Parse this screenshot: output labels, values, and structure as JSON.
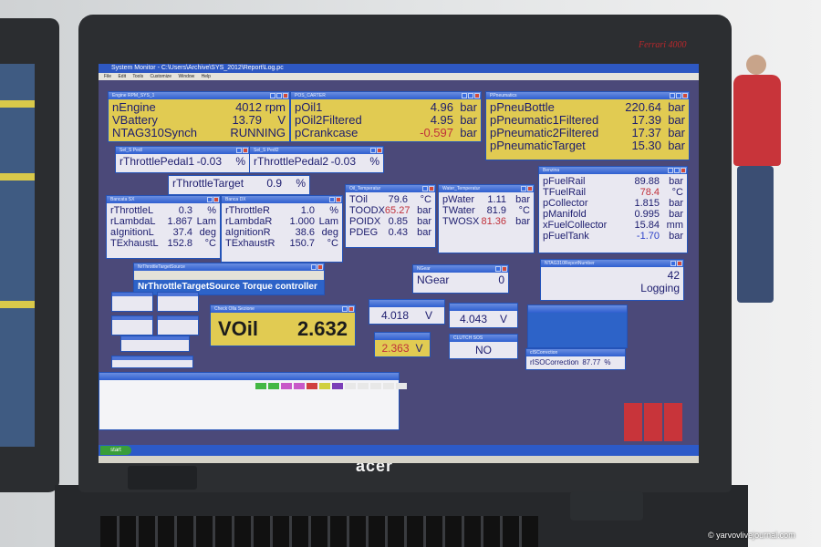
{
  "brand": {
    "lid_badge": "Ferrari 4000",
    "logo": "acer"
  },
  "watermark": "© yarvovlivejournal.com",
  "app": {
    "title": "System Monitor - C:\\Users\\Archive\\SYS_2012\\Report\\Log.pc",
    "menu": [
      "File",
      "Edit",
      "Tools",
      "Customize",
      "Window",
      "Help"
    ]
  },
  "windows": {
    "engine_rpm": {
      "title": "Engine RPM_SYS_1",
      "rows": [
        {
          "k": "nEngine",
          "v": "4012",
          "u": "rpm"
        },
        {
          "k": "VBattery",
          "v": "13.79",
          "u": "V"
        },
        {
          "k": "NTAG310Synch",
          "v": "RUNNING",
          "u": ""
        }
      ]
    },
    "pos_carter": {
      "title": "POS_CARTER",
      "rows": [
        {
          "k": "pOil1",
          "v": "4.96",
          "u": "bar"
        },
        {
          "k": "pOil2Filtered",
          "v": "4.95",
          "u": "bar"
        },
        {
          "k": "pCrankcase",
          "v": "-0.597",
          "u": "bar"
        }
      ]
    },
    "pneumatics": {
      "title": "PPneumatics",
      "rows": [
        {
          "k": "pPneuBottle",
          "v": "220.64",
          "u": "bar"
        },
        {
          "k": "pPneumatic1Filtered",
          "v": "17.39",
          "u": "bar"
        },
        {
          "k": "pPneumatic2Filtered",
          "v": "17.37",
          "u": "bar"
        },
        {
          "k": "pPneumaticTarget",
          "v": "15.30",
          "u": "bar"
        }
      ]
    },
    "pedal1": {
      "title": "Sel_S Pedl",
      "rows": [
        {
          "k": "rThrottlePedal1",
          "v": "-0.03",
          "u": "%"
        }
      ]
    },
    "pedal2": {
      "title": "Sel_S Pedl2",
      "rows": [
        {
          "k": "rThrottlePedal2",
          "v": "-0.03",
          "u": "%"
        }
      ]
    },
    "throttle_target": {
      "rows": [
        {
          "k": "rThrottleTarget",
          "v": "0.9",
          "u": "%"
        }
      ]
    },
    "bank_l": {
      "title": "Bancata SX",
      "rows": [
        {
          "k": "rThrottleL",
          "v": "0.3",
          "u": "%"
        },
        {
          "k": "rLambdaL",
          "v": "1.867",
          "u": "Lam"
        },
        {
          "k": "aIgnitionL",
          "v": "37.4",
          "u": "deg"
        },
        {
          "k": "TExhaustL",
          "v": "152.8",
          "u": "°C"
        }
      ]
    },
    "bank_r": {
      "title": "Banca DX",
      "rows": [
        {
          "k": "rThrottleR",
          "v": "1.0",
          "u": "%"
        },
        {
          "k": "rLambdaR",
          "v": "1.000",
          "u": "Lam"
        },
        {
          "k": "aIgnitionR",
          "v": "38.6",
          "u": "deg"
        },
        {
          "k": "TExhaustR",
          "v": "150.7",
          "u": "°C"
        }
      ]
    },
    "oil_temp": {
      "title": "Oil_Temperatur",
      "rows": [
        {
          "k": "TOil",
          "v": "79.6",
          "u": "°C"
        },
        {
          "k": "TOODX",
          "v": "65.27",
          "u": "bar"
        },
        {
          "k": "POIDX",
          "v": "0.85",
          "u": "bar"
        },
        {
          "k": "PDEG",
          "v": "0.43",
          "u": "bar"
        }
      ]
    },
    "water_temp": {
      "title": "Water_Temperatur",
      "rows": [
        {
          "k": "pWater",
          "v": "1.11",
          "u": "bar"
        },
        {
          "k": "TWater",
          "v": "81.9",
          "u": "°C"
        },
        {
          "k": "TWOSX",
          "v": "81.36",
          "u": "bar"
        }
      ]
    },
    "benzina": {
      "title": "Benzina",
      "rows": [
        {
          "k": "pFuelRail",
          "v": "89.88",
          "u": "bar"
        },
        {
          "k": "TFuelRail",
          "v": "78.4",
          "u": "°C"
        },
        {
          "k": "pCollector",
          "v": "1.815",
          "u": "bar"
        },
        {
          "k": "pManifold",
          "v": "0.995",
          "u": "bar"
        },
        {
          "k": "xFuelCollector",
          "v": "15.84",
          "u": "mm"
        },
        {
          "k": "pFuelTank",
          "v": "-1.70",
          "u": "bar"
        }
      ]
    },
    "throttle_source": {
      "title": "NrThrottleTargetSource",
      "value_row": "NrThrottleTargetSource  Torque controller"
    },
    "ngear": {
      "title": "NGear",
      "rows": [
        {
          "k": "NGear",
          "v": "0",
          "u": ""
        }
      ]
    },
    "logging": {
      "title": "NTAG310ReportNumber",
      "value": "42",
      "status": "Logging"
    },
    "volt_big": {
      "title": "Check Olla Sezione",
      "label": "VOil",
      "value": "2.632"
    },
    "volt_a": {
      "value": "4.018",
      "unit": "V"
    },
    "volt_b": {
      "value": "4.043",
      "unit": "V"
    },
    "volt_c": {
      "value": "2.363",
      "unit": "V"
    },
    "clutch": {
      "title": "CLUTCH SOS",
      "value": "NO"
    },
    "correction": {
      "title": "cISCorrection",
      "label": "rISOCorrection",
      "value": "87.77",
      "unit": "%"
    }
  },
  "taskbar": {
    "start": "start"
  }
}
